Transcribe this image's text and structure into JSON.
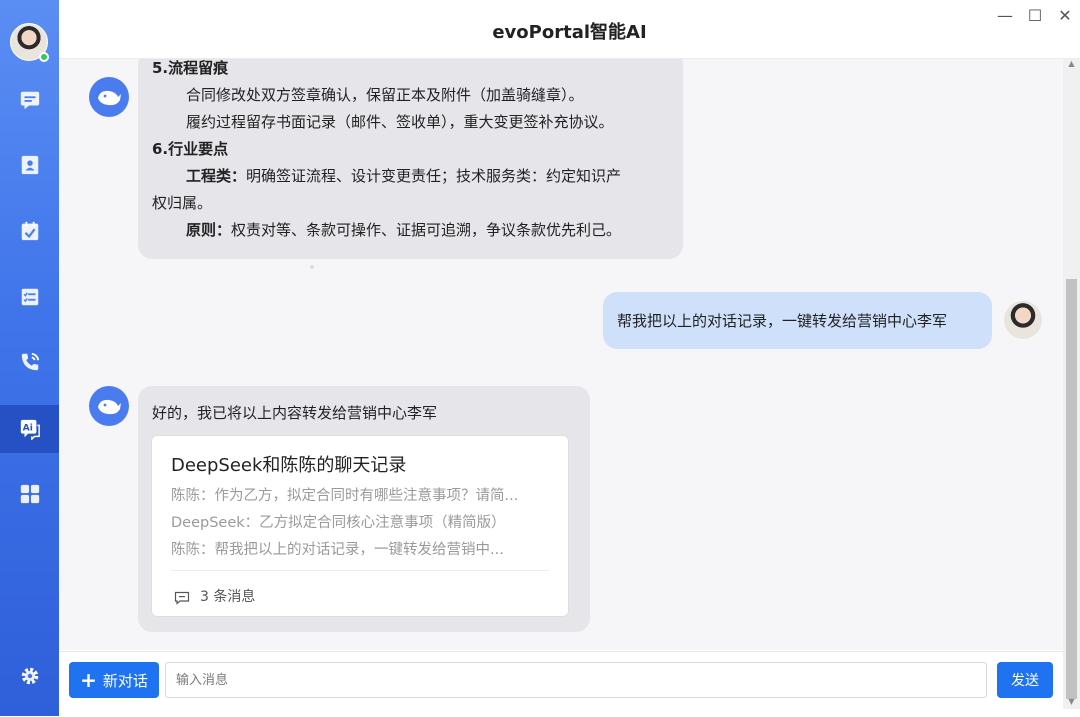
{
  "app": {
    "title": "evoPortal智能AI",
    "window_controls": [
      "—",
      "☐",
      "✕"
    ]
  },
  "sidebar": {
    "items": [
      {
        "icon": "message-icon"
      },
      {
        "icon": "contact-card-icon"
      },
      {
        "icon": "calendar-check-icon"
      },
      {
        "icon": "task-list-icon"
      },
      {
        "icon": "phone-icon"
      },
      {
        "icon": "ai-chat-icon",
        "active": true
      },
      {
        "icon": "apps-grid-icon"
      }
    ],
    "settings_icon": "gear-icon"
  },
  "messages": {
    "ai1": {
      "lines": [
        {
          "bold": "5.流程留痕",
          "text": ""
        },
        {
          "bold": "",
          "text": "合同修改处双方签章确认，保留正本及附件（加盖骑缝章）。"
        },
        {
          "bold": "",
          "text": "履约过程留存书面记录（邮件、签收单），重大变更签补充协议。"
        },
        {
          "bold": "6.行业要点",
          "text": ""
        },
        {
          "bold": "工程类：",
          "text": "明确签证流程、设计变更责任；技术服务类：约定知识产"
        },
        {
          "bold": "",
          "text": "权归属。"
        },
        {
          "bold": "原则：",
          "text": "权责对等、条款可操作、证据可追溯，争议条款优先利己。"
        }
      ]
    },
    "user1": {
      "text": "帮我把以上的对话记录，一键转发给营销中心李军"
    },
    "ai2": {
      "text": "好的，我已将以上内容转发给营销中心李军",
      "card": {
        "title": "DeepSeek和陈陈的聊天记录",
        "lines": [
          "陈陈：作为乙方，拟定合同时有哪些注意事项？请简...",
          "DeepSeek：乙方拟定合同核心注意事项（精简版）",
          "陈陈：帮我把以上的对话记录，一键转发给营销中..."
        ],
        "count": "3 条消息"
      }
    }
  },
  "composer": {
    "new_chat_label": "新对话",
    "new_chat_icon": "+",
    "placeholder": "输入消息",
    "send_label": "发送"
  },
  "colors": {
    "accent": "#1f73f0",
    "sidebar": "#3f74ea",
    "ai_bubble": "#e6e6ea",
    "user_bubble": "#cfe0fb"
  }
}
